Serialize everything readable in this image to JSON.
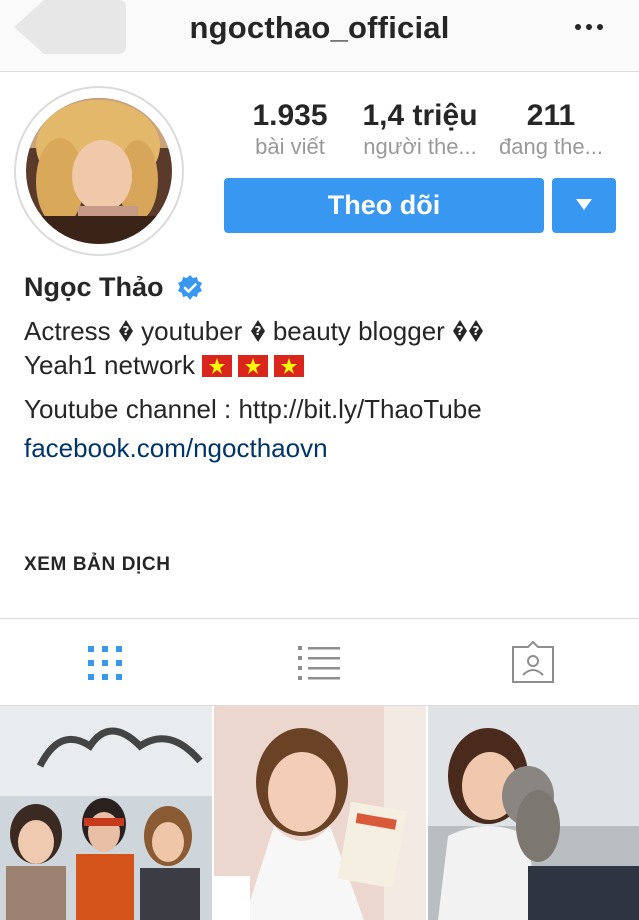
{
  "header": {
    "username": "ngocthao_official",
    "back_icon": "back-chevron-icon",
    "more_icon": "more-dots-icon"
  },
  "profile": {
    "display_name": "Ngọc Thảo",
    "verified": true,
    "stats": {
      "posts": {
        "value": "1.935",
        "label": "bài viết"
      },
      "followers": {
        "value": "1,4 triệu",
        "label": "người the..."
      },
      "following": {
        "value": "211",
        "label": "đang the..."
      }
    },
    "follow_button": "Theo dõi",
    "bio": {
      "line1_parts": [
        "Actress",
        "youtuber",
        "beauty blogger"
      ],
      "line2": "Yeah1 network",
      "line3": "Youtube channel : http://bit.ly/ThaoTube",
      "link": "facebook.com/ngocthaovn"
    },
    "translate_label": "XEM BẢN DỊCH"
  },
  "tabs": [
    {
      "name": "grid-view",
      "icon": "grid-icon",
      "active": true
    },
    {
      "name": "list-view",
      "icon": "list-icon",
      "active": false
    },
    {
      "name": "tagged",
      "icon": "tagged-user-icon",
      "active": false
    }
  ],
  "colors": {
    "accent": "#3897f0",
    "link": "#003569",
    "muted": "#999999",
    "border": "#dbdbdb",
    "flag_red": "#da251d",
    "flag_star": "#ffff00"
  }
}
